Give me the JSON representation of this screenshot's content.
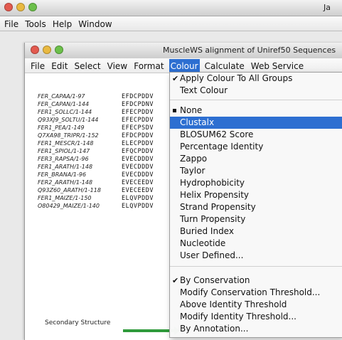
{
  "outer_window": {
    "title": "Ja",
    "menu": [
      "File",
      "Tools",
      "Help",
      "Window"
    ]
  },
  "inner_window": {
    "title": "MuscleWS alignment of Uniref50 Sequences",
    "menu": [
      "File",
      "Edit",
      "Select",
      "View",
      "Format",
      "Colour",
      "Calculate",
      "Web Service"
    ],
    "active_menu": "Colour"
  },
  "sequences": [
    {
      "name": "FER_CAPAA/1-97",
      "residues": "EFDCPDDV"
    },
    {
      "name": "FER_CAPAN/1-144",
      "residues": "EFDCPDNV"
    },
    {
      "name": "FER1_SOLLC/1-144",
      "residues": "EFECPDDV"
    },
    {
      "name": "Q93XJ9_SOLTU/1-144",
      "residues": "EFECPDDV"
    },
    {
      "name": "FER1_PEA/1-149",
      "residues": "EFECPSDV"
    },
    {
      "name": "Q7XA98_TRIPR/1-152",
      "residues": "EFDCPDDV"
    },
    {
      "name": "FER1_MESCR/1-148",
      "residues": "ELECPDDV"
    },
    {
      "name": "FER1_SPIOL/1-147",
      "residues": "EFQCPDDV"
    },
    {
      "name": "FER3_RAPSA/1-96",
      "residues": "EVECDDDV"
    },
    {
      "name": "FER1_ARATH/1-148",
      "residues": "EVECDDDV"
    },
    {
      "name": "FER_BRANA/1-96",
      "residues": "EVECDDDV"
    },
    {
      "name": "FER2_ARATH/1-148",
      "residues": "EVECEEDV"
    },
    {
      "name": "Q93Z60_ARATH/1-118",
      "residues": "EVECEEDV"
    },
    {
      "name": "FER1_MAIZE/1-150",
      "residues": "ELQVPDDV"
    },
    {
      "name": "O80429_MAIZE/1-140",
      "residues": "ELQVPDDV"
    }
  ],
  "secondary_structure_label": "Secondary Structure",
  "colour_menu": {
    "apply_to_all": "Apply Colour To All Groups",
    "text_colour": "Text Colour",
    "schemes": [
      "None",
      "Clustalx",
      "BLOSUM62 Score",
      "Percentage Identity",
      "Zappo",
      "Taylor",
      "Hydrophobicity",
      "Helix Propensity",
      "Strand Propensity",
      "Turn Propensity",
      "Buried Index",
      "Nucleotide",
      "User Defined..."
    ],
    "selected_scheme": "Clustalx",
    "by_conservation": "By Conservation",
    "modify_conservation": "Modify Conservation Threshold...",
    "above_identity": "Above Identity Threshold",
    "modify_identity": "Modify Identity Threshold...",
    "by_annotation": "By Annotation..."
  },
  "colors": {
    "menu_highlight": "#2d6fd1",
    "secondary_structure_arrow": "#2f9a3b"
  }
}
